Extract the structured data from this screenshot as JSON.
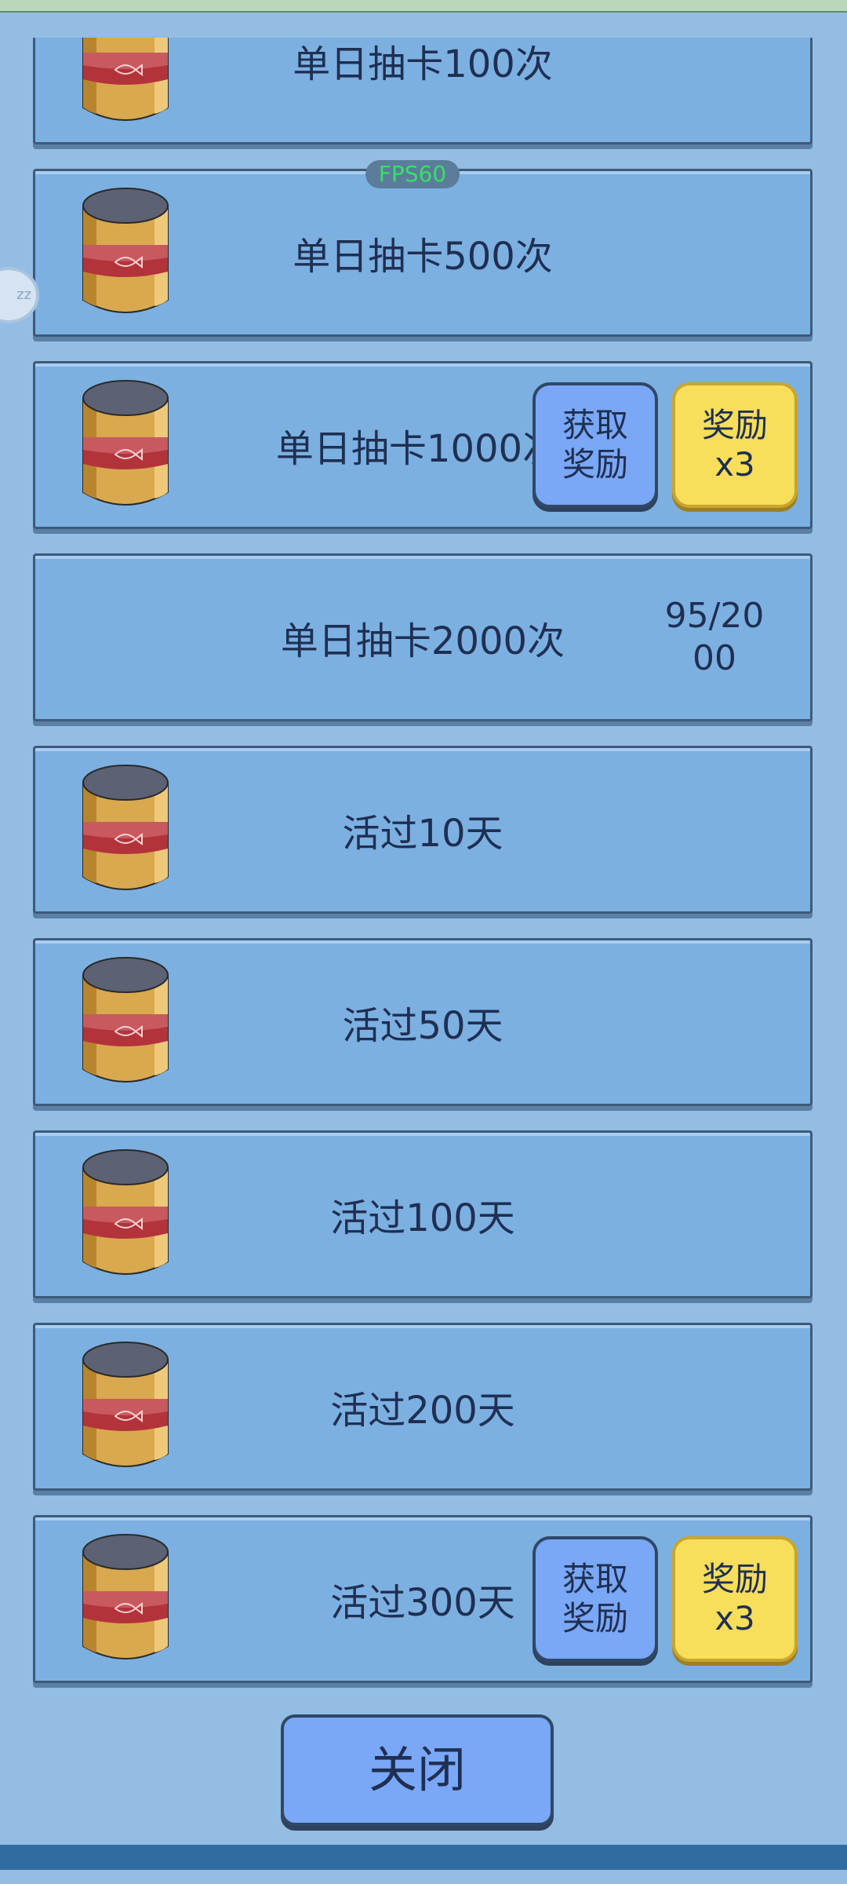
{
  "fps_badge": "FPS60",
  "side_button_label": "zz",
  "rows": [
    {
      "title": "单日抽卡100次",
      "has_can": true,
      "progress": "",
      "get_label": "",
      "x3_label": ""
    },
    {
      "title": "单日抽卡500次",
      "has_can": true,
      "progress": "",
      "get_label": "",
      "x3_label": ""
    },
    {
      "title": "单日抽卡1000次",
      "has_can": true,
      "progress": "",
      "get_label": "获取\n奖励",
      "x3_label": "奖励\nx3"
    },
    {
      "title": "单日抽卡2000次",
      "has_can": false,
      "progress": "95/20\n00",
      "get_label": "",
      "x3_label": ""
    },
    {
      "title": "活过10天",
      "has_can": true,
      "progress": "",
      "get_label": "",
      "x3_label": ""
    },
    {
      "title": "活过50天",
      "has_can": true,
      "progress": "",
      "get_label": "",
      "x3_label": ""
    },
    {
      "title": "活过100天",
      "has_can": true,
      "progress": "",
      "get_label": "",
      "x3_label": ""
    },
    {
      "title": "活过200天",
      "has_can": true,
      "progress": "",
      "get_label": "",
      "x3_label": ""
    },
    {
      "title": "活过300天",
      "has_can": true,
      "progress": "",
      "get_label": "获取\n奖励",
      "x3_label": "奖励\nx3"
    }
  ],
  "close_label": "关闭",
  "colors": {
    "panel": "#7cb0e1",
    "background": "#93bde2",
    "get_button": "#7aa7f6",
    "x3_button": "#f8de5a",
    "text": "#1f2f52"
  }
}
